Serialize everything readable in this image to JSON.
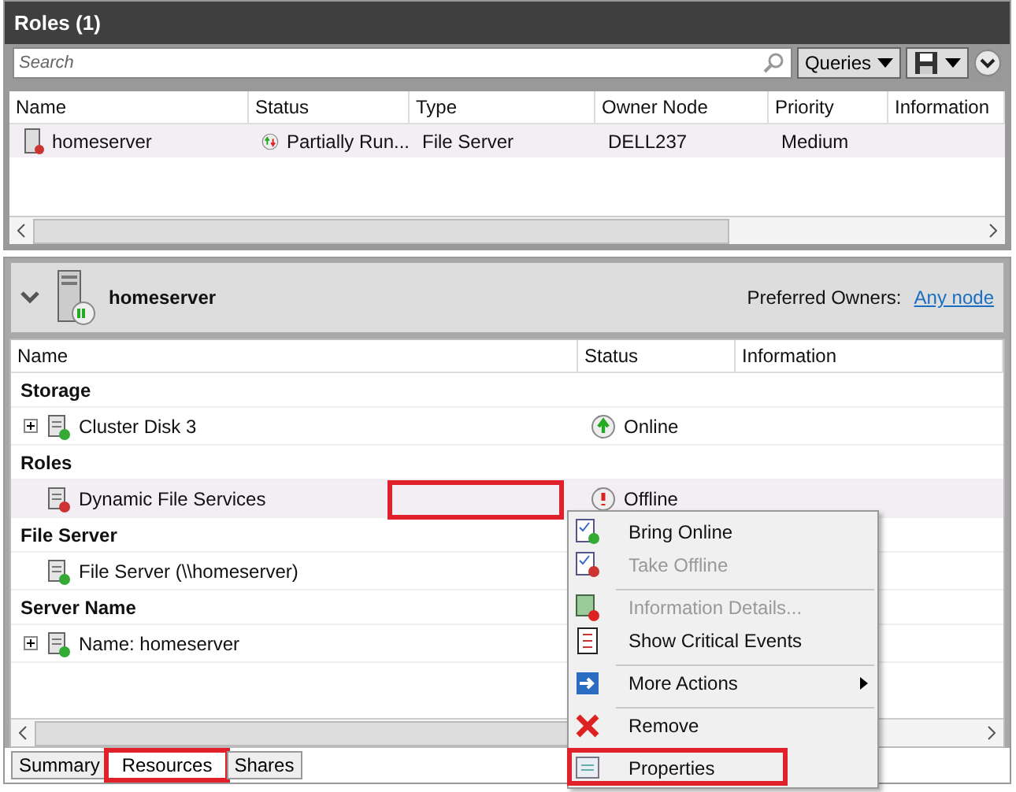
{
  "roles_panel": {
    "title": "Roles (1)",
    "search": {
      "placeholder": "Search"
    },
    "queries_button": "Queries",
    "table": {
      "columns": [
        "Name",
        "Status",
        "Type",
        "Owner Node",
        "Priority",
        "Information"
      ],
      "rows": [
        {
          "name": "homeserver",
          "status": "Partially Run...",
          "type": "File Server",
          "owner_node": "DELL237",
          "priority": "Medium",
          "selected": true
        }
      ]
    }
  },
  "detail_panel": {
    "title": "homeserver",
    "expanded": true,
    "preferred_owners_label": "Preferred Owners:",
    "preferred_owners_link": "Any node",
    "table": {
      "columns": [
        "Name",
        "Status",
        "Information"
      ],
      "groups": [
        {
          "name": "Storage",
          "items": [
            {
              "name": "Cluster Disk 3",
              "status": "Online",
              "kind": "online",
              "expandable": true,
              "selected": false
            }
          ]
        },
        {
          "name": "Roles",
          "items": [
            {
              "name": "Dynamic File Services",
              "status": "Offline",
              "kind": "offline",
              "expandable": false,
              "selected": true
            }
          ]
        },
        {
          "name": "File Server",
          "items": [
            {
              "name": "File Server (\\\\homeserver)",
              "kind": "plain",
              "expandable": false,
              "selected": false
            }
          ]
        },
        {
          "name": "Server Name",
          "items": [
            {
              "name": "Name: homeserver",
              "kind": "plain",
              "expandable": true,
              "selected": false
            }
          ]
        }
      ]
    }
  },
  "bottom_tabs": [
    {
      "label": "Summary",
      "selected": false,
      "highlighted": false
    },
    {
      "label": "Resources",
      "selected": true,
      "highlighted": true
    },
    {
      "label": "Shares",
      "selected": false,
      "highlighted": false
    }
  ],
  "context_menu": [
    {
      "label": "Bring Online",
      "disabled": false,
      "separator_before": false,
      "submenu": false,
      "highlighted": false,
      "kind": "online"
    },
    {
      "label": "Take Offline",
      "disabled": true,
      "separator_before": false,
      "submenu": false,
      "highlighted": false,
      "kind": "offline"
    },
    {
      "label": "Information Details...",
      "disabled": true,
      "separator_before": true,
      "submenu": false,
      "highlighted": false,
      "kind": "info"
    },
    {
      "label": "Show Critical Events",
      "disabled": false,
      "separator_before": false,
      "submenu": false,
      "highlighted": false,
      "kind": "events"
    },
    {
      "label": "More Actions",
      "disabled": false,
      "separator_before": true,
      "submenu": true,
      "highlighted": false,
      "kind": "more"
    },
    {
      "label": "Remove",
      "disabled": false,
      "separator_before": true,
      "submenu": false,
      "highlighted": false,
      "kind": "remove"
    },
    {
      "label": "Properties",
      "disabled": false,
      "separator_before": true,
      "submenu": false,
      "highlighted": true,
      "kind": "properties"
    }
  ]
}
